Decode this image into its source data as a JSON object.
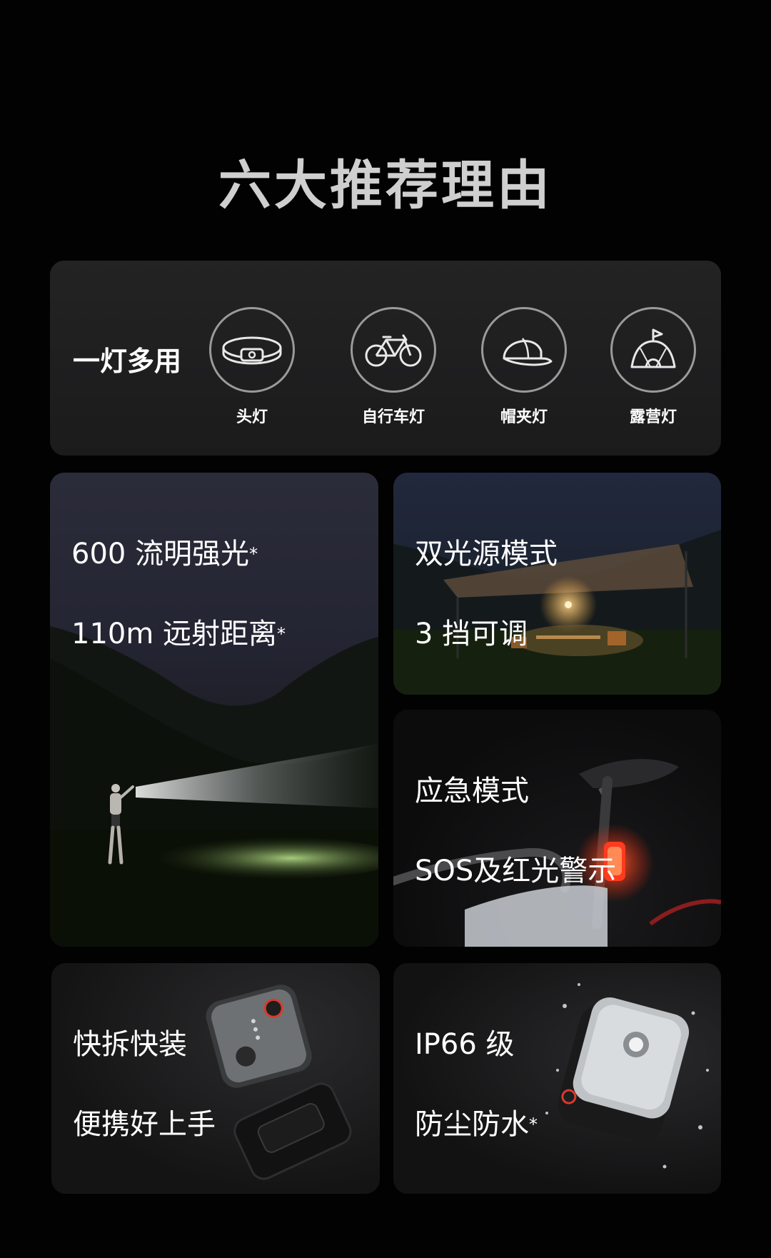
{
  "page": {
    "title": "六大推荐理由"
  },
  "multi_use": {
    "label": "一灯多用",
    "items": [
      {
        "label": "头灯",
        "icon": "headband-icon"
      },
      {
        "label": "自行车灯",
        "icon": "bicycle-icon"
      },
      {
        "label": "帽夹灯",
        "icon": "cap-icon"
      },
      {
        "label": "露营灯",
        "icon": "tent-icon"
      }
    ]
  },
  "features": [
    {
      "line1": "600 流明强光",
      "line2": "110m 远射距离",
      "mark": "*"
    },
    {
      "line1": "双光源模式",
      "line2": "3 挡可调"
    },
    {
      "line1": "应急模式",
      "line2": "SOS及红光警示"
    },
    {
      "line1": "快拆快装",
      "line2": "便携好上手"
    },
    {
      "line1": "IP66 级",
      "line2": "防尘防水",
      "mark": "*"
    }
  ],
  "colors": {
    "background": "#020203",
    "card": "#1f1f20",
    "tail_light": "#ff3b1f"
  }
}
